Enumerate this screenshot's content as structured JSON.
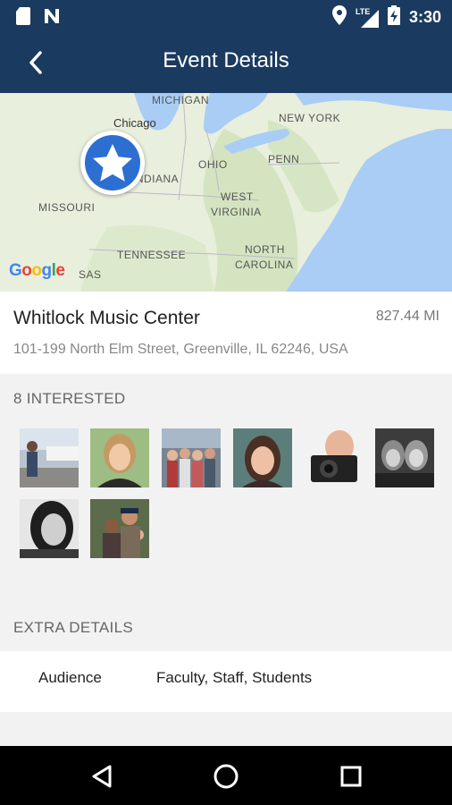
{
  "status_bar": {
    "time": "3:30",
    "network": "LTE",
    "icons": [
      "sd-card-icon",
      "n-notification-icon",
      "location-icon",
      "signal-icon",
      "battery-charging-icon"
    ]
  },
  "app_bar": {
    "title": "Event Details",
    "back_icon": "chevron-left-icon"
  },
  "map": {
    "labels": [
      "MICHIGAN",
      "NEW YORK",
      "Chicago",
      "OHIO",
      "PENN",
      "INDIANA",
      "WEST",
      "VIRGINIA",
      "MISSOURI",
      "TENNESSEE",
      "NORTH",
      "CAROLINA",
      "SAS"
    ],
    "attribution": "Google",
    "marker_icon": "star-icon"
  },
  "venue": {
    "name": "Whitlock Music Center",
    "distance": "827.44 MI",
    "address": "101-199 North Elm Street, Greenville, IL 62246, USA"
  },
  "interested": {
    "header": "8 INTERESTED",
    "count": 8
  },
  "extra_details": {
    "header": "EXTRA DETAILS",
    "rows": [
      {
        "key": "Audience",
        "value": "Faculty, Staff, Students"
      }
    ]
  },
  "nav_bar": {
    "icons": [
      "back-triangle-icon",
      "home-circle-icon",
      "recents-square-icon"
    ]
  },
  "colors": {
    "primary": "#1b3a60",
    "marker": "#2c6fd1",
    "water": "#a9cdf5",
    "land": "#e8efdc"
  }
}
